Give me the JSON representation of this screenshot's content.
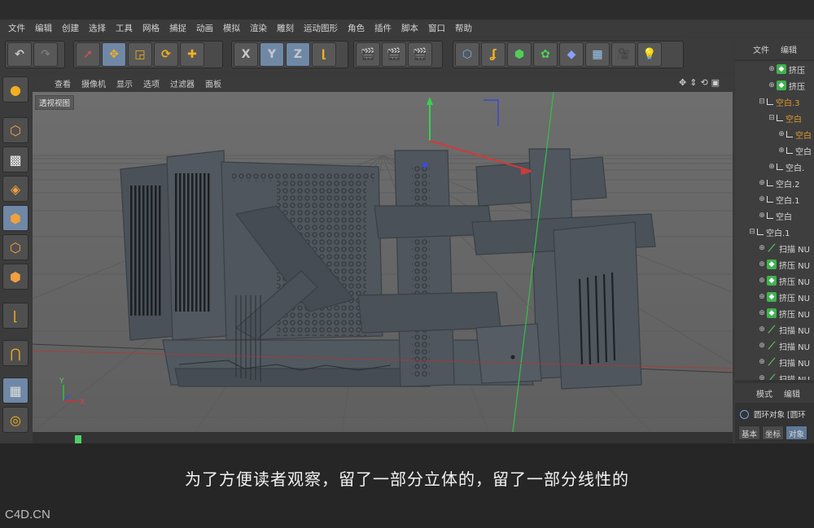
{
  "menu": [
    "文件",
    "编辑",
    "创建",
    "选择",
    "工具",
    "网格",
    "捕捉",
    "动画",
    "模拟",
    "渲染",
    "雕刻",
    "运动图形",
    "角色",
    "插件",
    "脚本",
    "窗口",
    "帮助"
  ],
  "toolbar": {
    "undo_icon": "undo-icon",
    "redo_icon": "redo-icon",
    "x_label": "X",
    "y_label": "Y",
    "z_label": "Z"
  },
  "viewport": {
    "menu": [
      "查看",
      "摄像机",
      "显示",
      "选项",
      "过滤器",
      "面板"
    ],
    "label": "透视视图",
    "axis_y": "Y",
    "axis_x": "X"
  },
  "object_manager": {
    "tabs": [
      "文件",
      "编辑"
    ],
    "rows": [
      {
        "label": "挤压",
        "icon": "extrude",
        "expander": "⊕",
        "indent": 40,
        "color": "normal"
      },
      {
        "label": "挤压",
        "icon": "extrude",
        "expander": "⊕",
        "indent": 40,
        "color": "normal"
      },
      {
        "label": "空白.3",
        "icon": "null",
        "expander": "⊟",
        "indent": 28,
        "color": "orange"
      },
      {
        "label": "空白",
        "icon": "null",
        "expander": "⊟",
        "indent": 40,
        "color": "orange"
      },
      {
        "label": "空白",
        "icon": "null",
        "expander": "⊕",
        "indent": 52,
        "color": "orange"
      },
      {
        "label": "空白",
        "icon": "null",
        "expander": "⊕",
        "indent": 52,
        "color": "normal"
      },
      {
        "label": "空白.",
        "icon": "null",
        "expander": "⊕",
        "indent": 40,
        "color": "normal"
      },
      {
        "label": "空白.2",
        "icon": "null",
        "expander": "⊕",
        "indent": 28,
        "color": "normal"
      },
      {
        "label": "空白.1",
        "icon": "null",
        "expander": "⊕",
        "indent": 28,
        "color": "normal"
      },
      {
        "label": "空白",
        "icon": "null",
        "expander": "⊕",
        "indent": 28,
        "color": "normal"
      },
      {
        "label": "空白.1",
        "icon": "null",
        "expander": "⊟",
        "indent": 16,
        "color": "normal"
      },
      {
        "label": "扫描 NU",
        "icon": "sweep",
        "expander": "⊕",
        "indent": 28,
        "color": "normal"
      },
      {
        "label": "挤压 NU",
        "icon": "extrude",
        "expander": "⊕",
        "indent": 28,
        "color": "normal"
      },
      {
        "label": "挤压 NU",
        "icon": "extrude",
        "expander": "⊕",
        "indent": 28,
        "color": "normal"
      },
      {
        "label": "挤压 NU",
        "icon": "extrude",
        "expander": "⊕",
        "indent": 28,
        "color": "normal"
      },
      {
        "label": "挤压 NU",
        "icon": "extrude",
        "expander": "⊕",
        "indent": 28,
        "color": "normal"
      },
      {
        "label": "扫描 NU",
        "icon": "sweep",
        "expander": "⊕",
        "indent": 28,
        "color": "normal"
      },
      {
        "label": "扫描 NU",
        "icon": "sweep",
        "expander": "⊕",
        "indent": 28,
        "color": "normal"
      },
      {
        "label": "扫描 NU",
        "icon": "sweep",
        "expander": "⊕",
        "indent": 28,
        "color": "normal"
      },
      {
        "label": "扫描 NU",
        "icon": "sweep",
        "expander": "⊕",
        "indent": 28,
        "color": "normal"
      }
    ]
  },
  "attributes": {
    "tabs": [
      "模式",
      "编辑"
    ],
    "object": "圆环对象 [圆环",
    "subtabs": [
      "基本",
      "坐标",
      "对象"
    ],
    "active_subtab": 2
  },
  "caption": "为了方便读者观察，留了一部分立体的，留了一部分线性的",
  "watermark": "C4D.CN",
  "colors": {
    "active": "#6f88a6",
    "highlight": "#e09a2a",
    "extrude": "#3fb24f"
  }
}
